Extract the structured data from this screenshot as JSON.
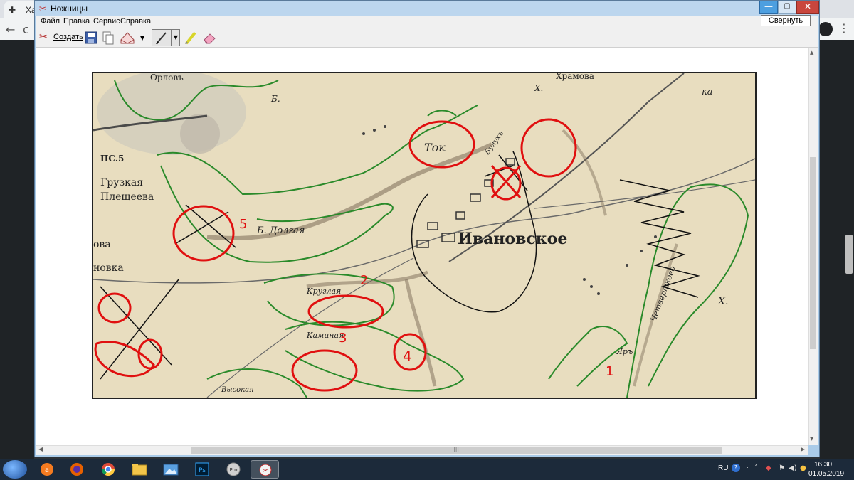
{
  "browser": {
    "tab_title": "Ха",
    "tab_icon": "puzzle-icon"
  },
  "window": {
    "title": "Ножницы",
    "minimize_tooltip": "Свернуть"
  },
  "menu": {
    "file": "Файл",
    "edit": "Правка",
    "service": "Сервис",
    "help": "Справка"
  },
  "toolbar": {
    "new_label": "Создать"
  },
  "map": {
    "labels": {
      "village": "Ивановское",
      "tok": "Ток",
      "b_dolgaya": "Б. Долгая",
      "gruzkaya": "Грузкая",
      "pleshcheeva": "Плещеева",
      "balka_chetvertkova": "Четвертково",
      "yar": "Яръ",
      "x1": "Х.",
      "kh": "Х.",
      "ka": "ка",
      "b_label": "Б.",
      "pc5": "ПС.5",
      "novka": "новка",
      "ova": "ова",
      "bulukh": "Булухъ",
      "kruglaya": "Круглая",
      "kaminaya": "Каминая",
      "vysokaya": "Высокая",
      "orlov": "Орловъ",
      "khramova": "Храмова"
    },
    "annotations": [
      "1",
      "2",
      "3",
      "4",
      "5"
    ]
  },
  "taskbar": {
    "language": "RU",
    "time": "16:30",
    "date": "01.05.2019"
  },
  "colors": {
    "map_paper": "#e8ddbf",
    "red_marker": "#e01010",
    "green_outline": "#2a8a2a",
    "black_pen": "#111111"
  }
}
